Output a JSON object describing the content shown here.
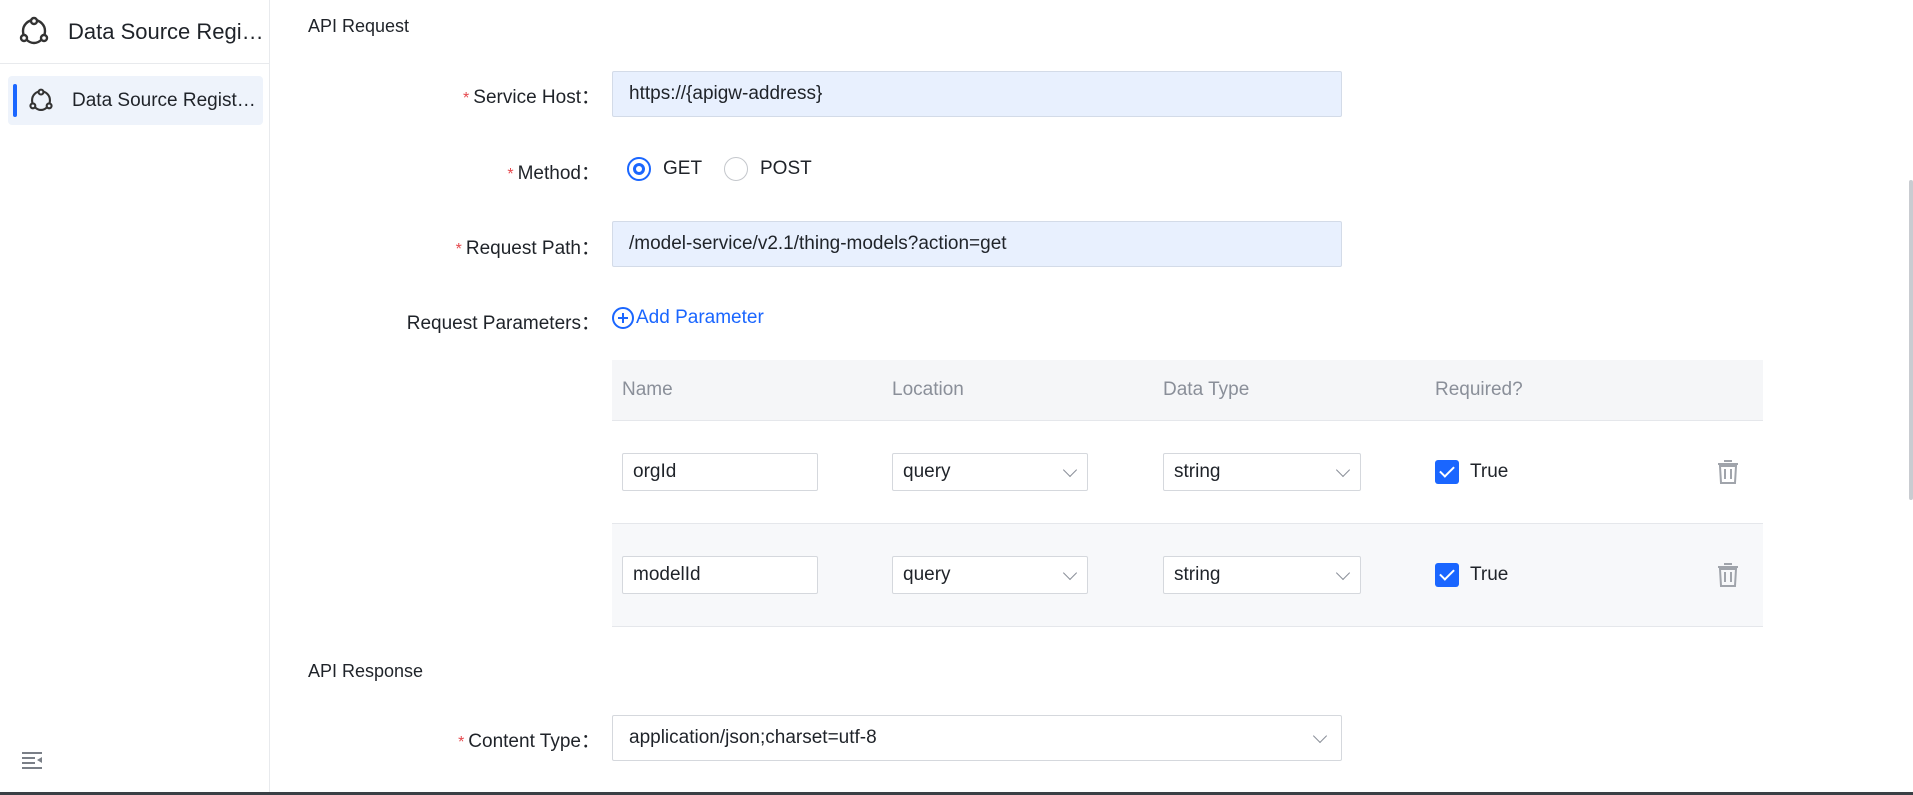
{
  "sidebar": {
    "app_title": "Data Source Registration",
    "items": [
      {
        "label": "Data Source Registration",
        "active": true
      }
    ],
    "collapse_icon": "menu-collapse-icon"
  },
  "api_request": {
    "section_title": "API Request",
    "service_host": {
      "label": "Service Host",
      "value": "https://{apigw-address}",
      "required": true
    },
    "method": {
      "label": "Method",
      "required": true,
      "options": [
        {
          "label": "GET",
          "checked": true
        },
        {
          "label": "POST",
          "checked": false
        }
      ]
    },
    "request_path": {
      "label": "Request Path",
      "value": "/model-service/v2.1/thing-models?action=get",
      "required": true
    },
    "request_parameters": {
      "label": "Request Parameters",
      "add_label": "Add Parameter",
      "columns": [
        "Name",
        "Location",
        "Data Type",
        "Required?"
      ],
      "rows": [
        {
          "name": "orgId",
          "location": "query",
          "data_type": "string",
          "required": "True"
        },
        {
          "name": "modelId",
          "location": "query",
          "data_type": "string",
          "required": "True"
        }
      ]
    }
  },
  "api_response": {
    "section_title": "API Response",
    "content_type": {
      "label": "Content Type",
      "value": "application/json;charset=utf-8",
      "required": true
    }
  },
  "colors": {
    "accent": "#1a66ff",
    "input_fill": "#e8f0fe",
    "required": "#e5484d"
  },
  "separator": "："
}
